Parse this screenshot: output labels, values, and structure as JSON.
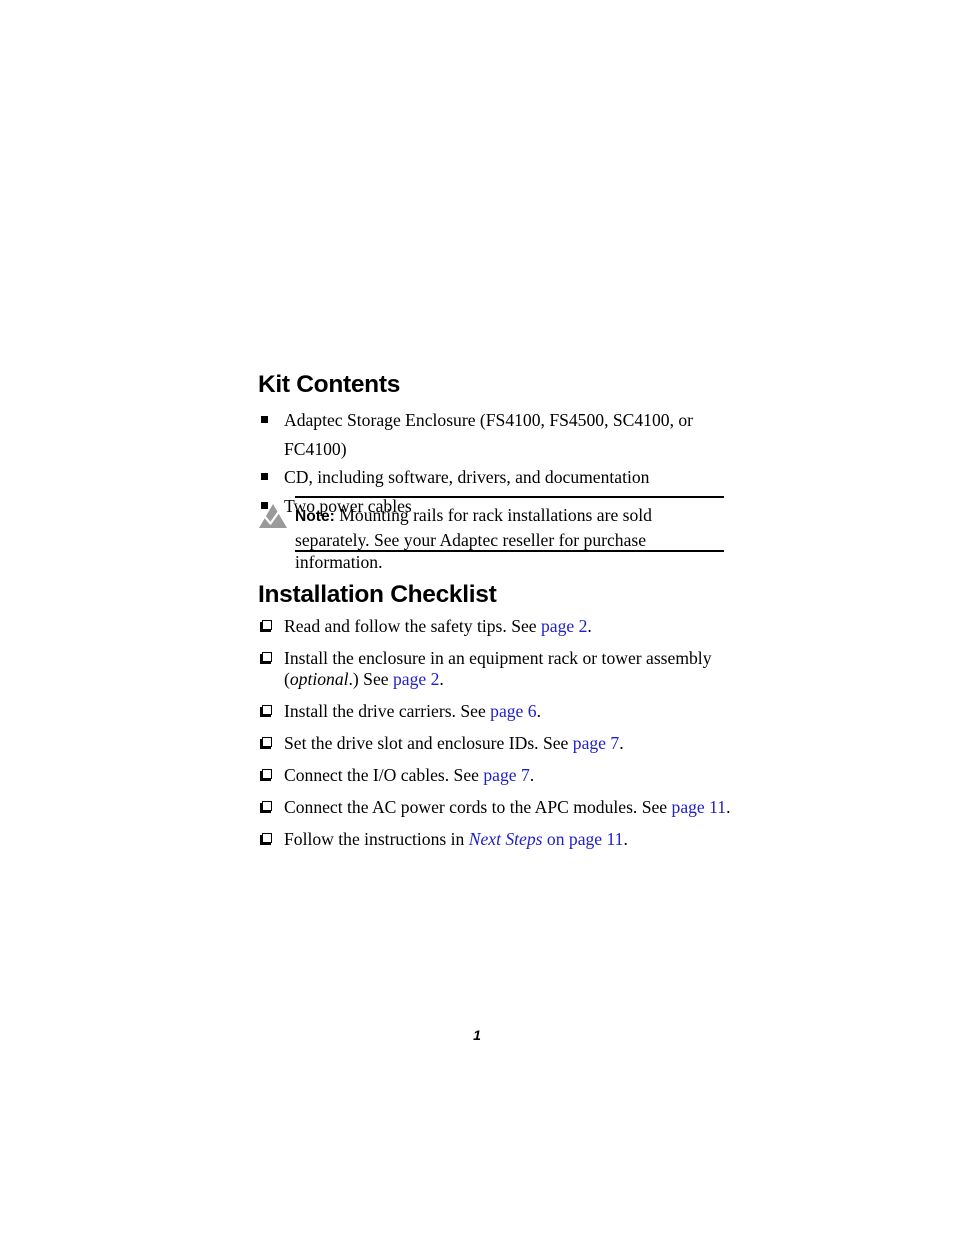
{
  "document": {
    "page_number": "1",
    "link_color": "#2020cc",
    "text_color": "#000000",
    "background_color": "#ffffff"
  },
  "kit_contents": {
    "heading": "Kit Contents",
    "bullet_icon": "filled-square-bullet",
    "items": [
      "Adaptec Storage Enclosure (FS4100, FS4500, SC4100, or FC4100)",
      "CD, including software, drivers, and documentation",
      "Two power cables"
    ]
  },
  "note": {
    "icon": "note-triangle-checkmark-icon",
    "label": "Note:",
    "text": "Mounting rails for rack installations are sold separately. See your Adaptec reseller for purchase information.",
    "icon_fill": "#9a9a9a"
  },
  "installation_checklist": {
    "heading": "Installation Checklist",
    "checkbox_icon": "shadowed-square-checkbox-icon",
    "items": [
      {
        "text_before": "Read and follow the safety tips. See ",
        "link": "page 2",
        "text_after": "."
      },
      {
        "text_before": "Install the enclosure in an equipment rack or tower assembly (",
        "italic_mid": "optional",
        "text_mid": ".) See ",
        "link": "page 2",
        "text_after": "."
      },
      {
        "text_before": "Install the drive carriers. See ",
        "link": "page 6",
        "text_after": "."
      },
      {
        "text_before": "Set the drive slot and enclosure IDs. See ",
        "link": "page 7",
        "text_after": "."
      },
      {
        "text_before": "Connect the I/O cables. See ",
        "link": "page 7",
        "text_after": "."
      },
      {
        "text_before": "Connect the AC power cords to the APC modules. See ",
        "link": "page 11",
        "text_after": "."
      },
      {
        "text_before": "Follow the instructions in ",
        "link_italic": "Next Steps",
        "link_rest": " on page 11",
        "text_after": "."
      }
    ]
  }
}
